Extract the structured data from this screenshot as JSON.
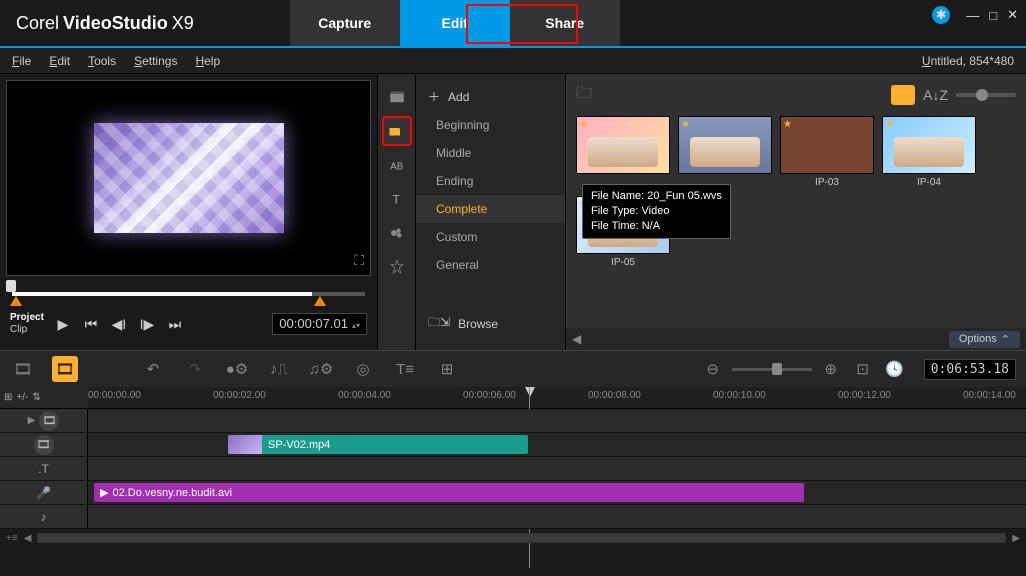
{
  "app": {
    "brand": "Corel",
    "name": "VideoStudio",
    "version": "X9"
  },
  "tabs": {
    "capture": "Capture",
    "edit": "Edit",
    "share": "Share"
  },
  "menu": {
    "file": "File",
    "edit": "Edit",
    "tools": "Tools",
    "settings": "Settings",
    "help": "Help"
  },
  "document": "Untitled, 854*480",
  "preview": {
    "mode_a": "Project",
    "mode_b": "Clip",
    "timecode": "00:00:07.01"
  },
  "library": {
    "add": "Add",
    "categories": {
      "beginning": "Beginning",
      "middle": "Middle",
      "ending": "Ending",
      "complete": "Complete",
      "custom": "Custom",
      "general": "General"
    },
    "browse": "Browse",
    "thumbs": {
      "t3": "IP-03",
      "t4": "IP-04",
      "t5": "IP-05"
    },
    "tooltip": {
      "l1": "File Name: 20_Fun 05.wvs",
      "l2": "File Type: Video",
      "l3": "File Time: N/A"
    },
    "options": "Options"
  },
  "timeline": {
    "timecode": "0:06:53.18",
    "ticks": [
      "00:00:00.00",
      "00:00:02.00",
      "00:00:04.00",
      "00:00:06.00",
      "00:00:08.00",
      "00:00:10.00",
      "00:00:12.00",
      "00:00:14.00"
    ],
    "clips": {
      "video": "SP-V02.mp4",
      "audio": "02.Do.vesny.ne.budit.avi"
    }
  }
}
